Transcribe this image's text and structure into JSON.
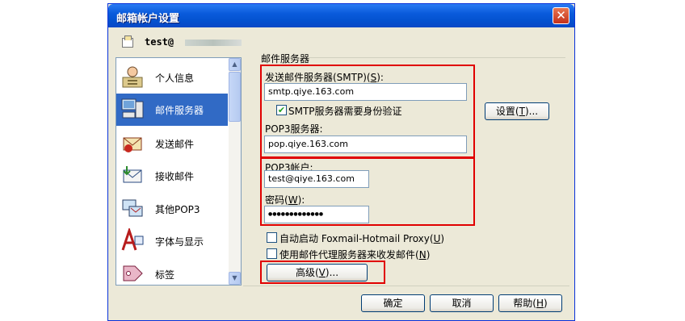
{
  "window": {
    "title": "邮箱帐户设置",
    "close_symbol": "✕"
  },
  "account": {
    "label": "test@"
  },
  "sidebar": {
    "items": [
      {
        "label": "个人信息",
        "icon": "person-card-icon"
      },
      {
        "label": "邮件服务器",
        "icon": "server-computer-icon",
        "selected": true
      },
      {
        "label": "发送邮件",
        "icon": "send-mail-icon"
      },
      {
        "label": "接收邮件",
        "icon": "receive-mail-icon"
      },
      {
        "label": "其他POP3",
        "icon": "other-pop3-icon"
      },
      {
        "label": "字体与显示",
        "icon": "font-display-icon"
      },
      {
        "label": "标签",
        "icon": "tag-label-icon"
      }
    ]
  },
  "server": {
    "group_title": "邮件服务器",
    "smtp_label": "发送邮件服务器(SMTP)",
    "smtp_key": "S",
    "smtp_value": "smtp.qiye.163.com",
    "smtp_auth_label": "SMTP服务器需要身份验证",
    "smtp_auth_checked": true,
    "settings_button": "设置",
    "settings_key": "T",
    "pop3_label": "POP3服务器:",
    "pop3_value": "pop.qiye.163.com",
    "pop3_account_label": "POP3帐户:",
    "pop3_account_value": "test@qiye.163.com",
    "password_label": "密码",
    "password_key": "W",
    "password_value": "●●●●●●●●●●●●●",
    "autostart_label": "自动启动 Foxmail-Hotmail Proxy",
    "autostart_key": "U",
    "autostart_checked": false,
    "proxy_label": "使用邮件代理服务器来收发邮件",
    "proxy_key": "N",
    "proxy_checked": false,
    "advanced_button": "高级",
    "advanced_key": "V"
  },
  "footer": {
    "ok": "确定",
    "cancel": "取消",
    "help": "帮助",
    "help_key": "H"
  },
  "colors": {
    "selection": "#316AC5",
    "highlight_box": "#E00000",
    "titlebar": "#0A5BDC"
  }
}
